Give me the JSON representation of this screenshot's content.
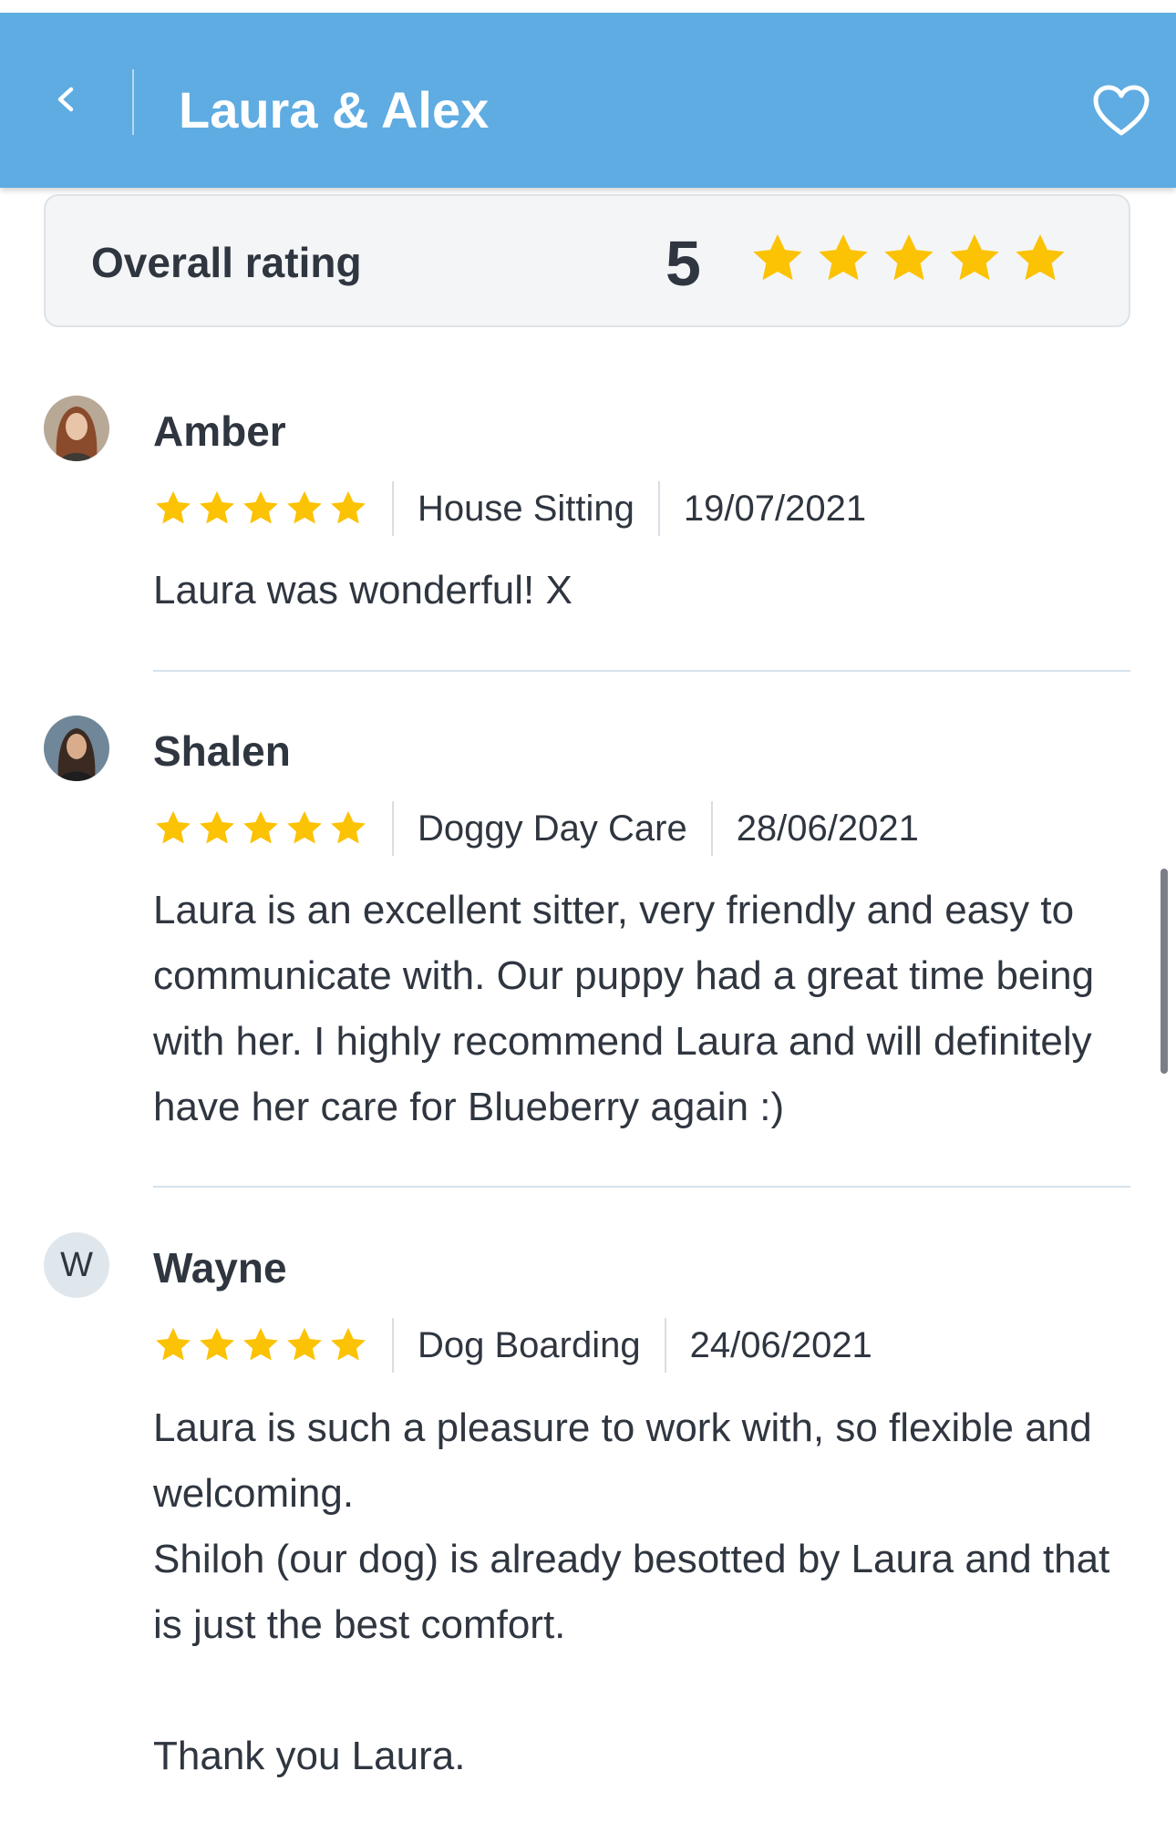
{
  "header": {
    "title": "Laura & Alex"
  },
  "overall": {
    "label": "Overall rating",
    "score": "5",
    "stars": 5
  },
  "colors": {
    "header_bg": "#5eace2",
    "star": "#fcc204",
    "text": "#2f3640"
  },
  "reviews": [
    {
      "name": "Amber",
      "stars": 5,
      "service": "House Sitting",
      "date": "19/07/2021",
      "text": "Laura was wonderful! X",
      "avatar": "photo"
    },
    {
      "name": "Shalen",
      "stars": 5,
      "service": "Doggy Day Care",
      "date": "28/06/2021",
      "text": "Laura is an excellent sitter, very friendly and easy to communicate with. Our puppy had a great time being with her. I highly recommend Laura and will definitely have her care for Blueberry again :)",
      "avatar": "photo"
    },
    {
      "name": "Wayne",
      "stars": 5,
      "service": "Dog Boarding",
      "date": "24/06/2021",
      "text": "Laura is such a pleasure to work with, so flexible and welcoming.\nShiloh (our dog) is already besotted by Laura and that is just the best comfort.\n\nThank you Laura.",
      "avatar_initial": "W"
    }
  ]
}
